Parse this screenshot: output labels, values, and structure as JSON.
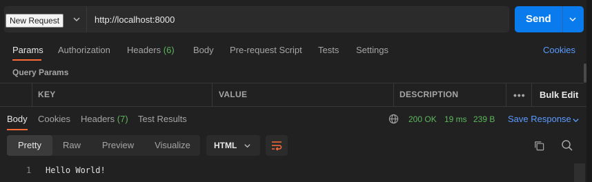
{
  "request": {
    "method_tooltip": "New Request",
    "url": "http://localhost:8000",
    "send_label": "Send"
  },
  "request_tabs": [
    {
      "label": "Params",
      "count": "",
      "active": true
    },
    {
      "label": "Authorization",
      "count": "",
      "active": false
    },
    {
      "label": "Headers",
      "count": "(6)",
      "active": false
    },
    {
      "label": "Body",
      "count": "",
      "active": false
    },
    {
      "label": "Pre-request Script",
      "count": "",
      "active": false
    },
    {
      "label": "Tests",
      "count": "",
      "active": false
    },
    {
      "label": "Settings",
      "count": "",
      "active": false
    }
  ],
  "cookies_link": "Cookies",
  "query_params": {
    "section_label": "Query Params",
    "columns": [
      "KEY",
      "VALUE",
      "DESCRIPTION"
    ],
    "more_label": "•••",
    "bulk_edit": "Bulk Edit"
  },
  "response": {
    "tabs": [
      {
        "label": "Body",
        "count": "",
        "active": true
      },
      {
        "label": "Cookies",
        "count": "",
        "active": false
      },
      {
        "label": "Headers",
        "count": "(7)",
        "active": false
      },
      {
        "label": "Test Results",
        "count": "",
        "active": false
      }
    ],
    "status": "200 OK",
    "time": "19 ms",
    "size": "239 B",
    "save_label": "Save Response",
    "view_modes": [
      "Pretty",
      "Raw",
      "Preview",
      "Visualize"
    ],
    "active_view": "Pretty",
    "format": "HTML",
    "lines": [
      {
        "no": "1",
        "text": "Hello World!"
      }
    ]
  },
  "colors": {
    "accent_orange": "#ff6c37",
    "send_blue": "#097bed",
    "link_blue": "#5b9bff",
    "status_green": "#5cb85c",
    "background": "#212121"
  },
  "icons": [
    "chevron-down-icon",
    "globe-icon",
    "wrap-lines-icon",
    "copy-icon",
    "search-icon"
  ]
}
